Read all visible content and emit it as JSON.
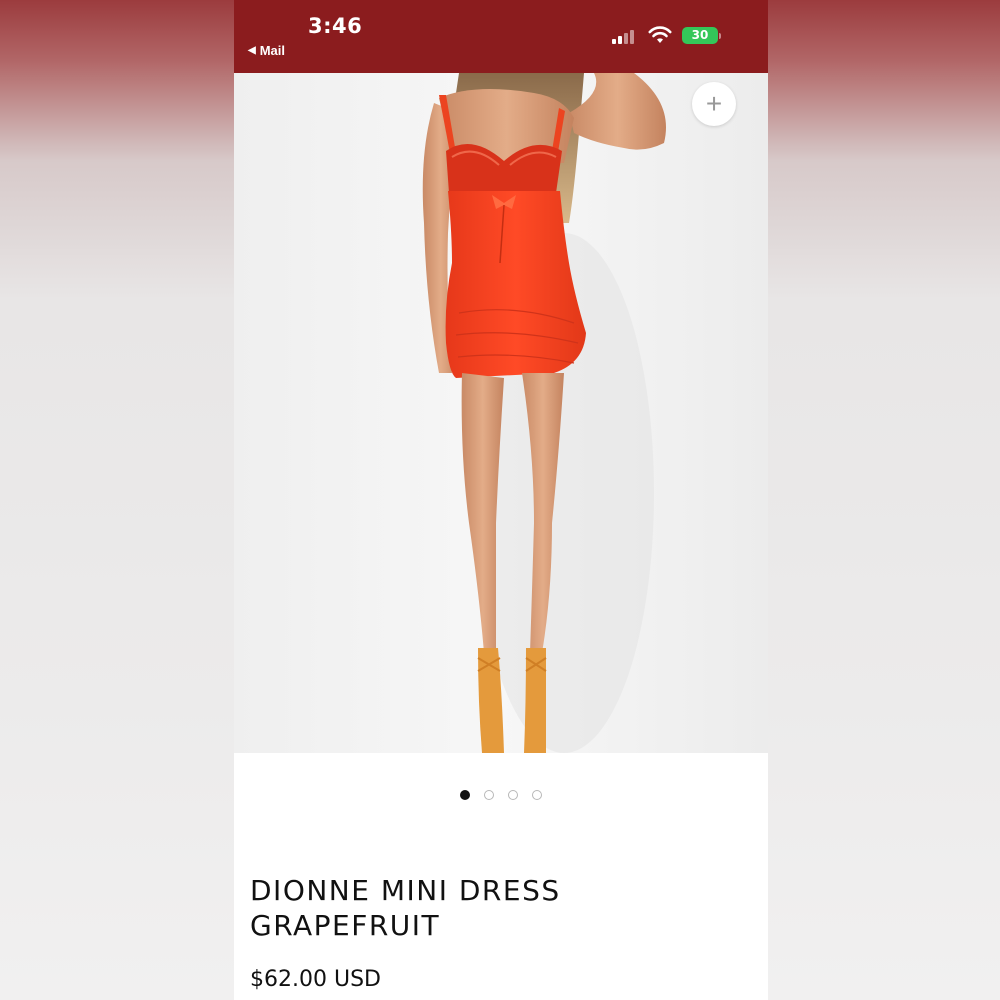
{
  "status_bar": {
    "time": "3:46",
    "back_app": "Mail",
    "battery": "30",
    "bar_color": "#8b1c1e"
  },
  "product_image": {
    "alt": "Model wearing orange-red lace-trimmed mini dress with lace-up heels"
  },
  "actions": {
    "add": "+"
  },
  "carousel": {
    "count": 4,
    "active_index": 0
  },
  "product": {
    "title_line1": "DIONNE MINI DRESS",
    "title_line2": "GRAPEFRUIT",
    "price": "$62.00 USD"
  },
  "colors": {
    "dress": "#f1401f",
    "battery": "#34c759"
  }
}
